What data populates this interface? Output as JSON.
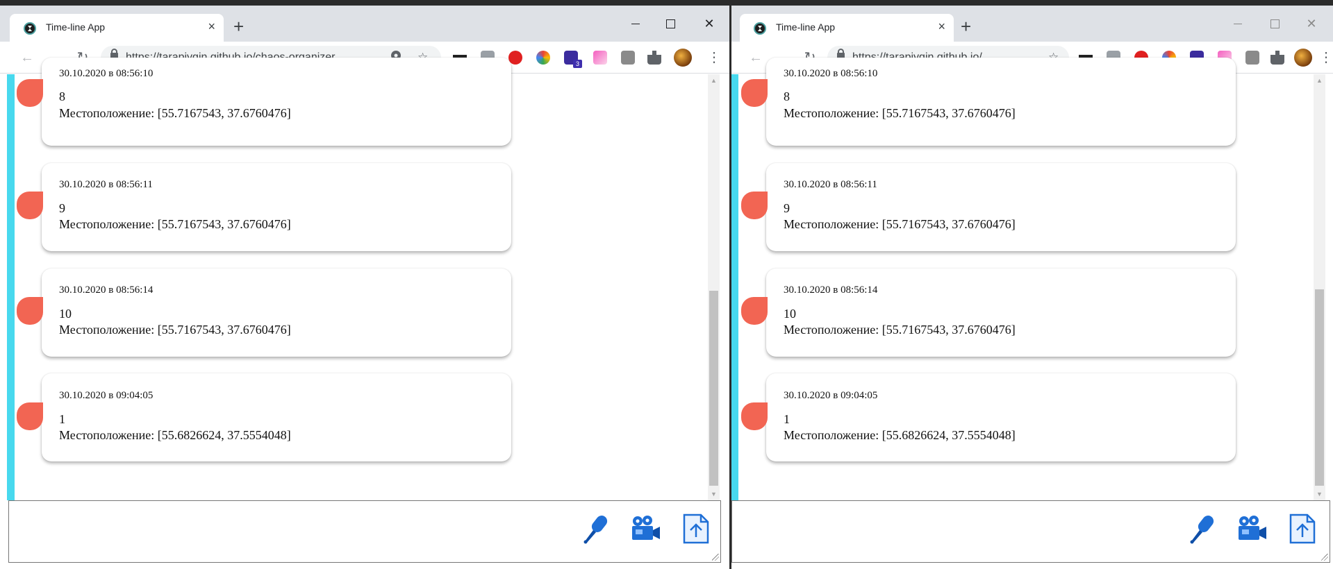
{
  "browser": {
    "tab_title": "Time-line App",
    "tab_close": "×",
    "new_tab": "+",
    "url_left": "https://tarapiygin.github.io/chaos-organizer...",
    "url_right": "https://tarapiygin.github.io/...",
    "window_controls": {
      "minimize": "",
      "maximize": "",
      "close": "✕"
    },
    "extension_badge": "3",
    "nav": {
      "back": "←",
      "forward": "→",
      "reload": "↻",
      "menu": "⋮"
    }
  },
  "colors": {
    "accent_stripe": "#48d9ee",
    "marker": "#f26553",
    "tool_icons": "#1f6fd6"
  },
  "timeline": {
    "location_prefix": "Местоположение:",
    "entries": [
      {
        "date": "30.10.2020 в 08:56:10",
        "text": "8",
        "location": "Местоположение: [55.7167543, 37.6760476]"
      },
      {
        "date": "30.10.2020 в 08:56:11",
        "text": "9",
        "location": "Местоположение: [55.7167543, 37.6760476]"
      },
      {
        "date": "30.10.2020 в 08:56:14",
        "text": "10",
        "location": "Местоположение: [55.7167543, 37.6760476]"
      },
      {
        "date": "30.10.2020 в 09:04:05",
        "text": "1",
        "location": "Местоположение: [55.6826624, 37.5554048]"
      }
    ]
  },
  "composer": {
    "value": "",
    "tools": [
      "microphone-icon",
      "video-camera-icon",
      "file-upload-icon"
    ]
  }
}
